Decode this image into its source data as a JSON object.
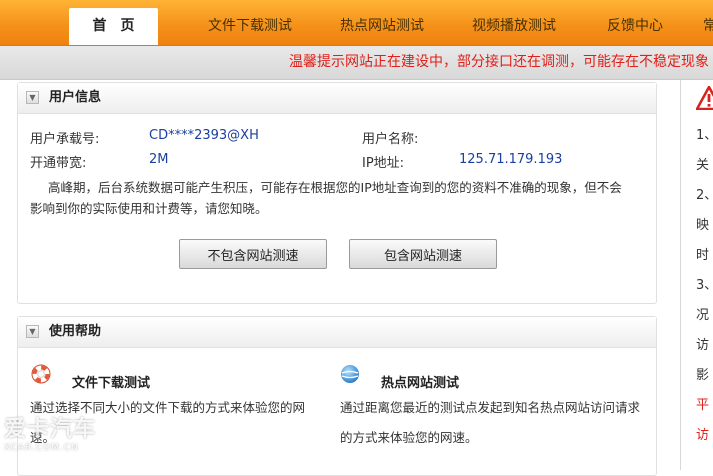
{
  "nav": {
    "tabs": [
      {
        "label": "首页"
      },
      {
        "label": "文件下载测试"
      },
      {
        "label": "热点网站测试"
      },
      {
        "label": "视频播放测试"
      },
      {
        "label": "反馈中心"
      },
      {
        "label": "常"
      }
    ]
  },
  "notice": {
    "text": "温馨提示网站正在建设中，部分接口还在调测，可能存在不稳定现象"
  },
  "user_info": {
    "title": "用户信息",
    "account_label": "用户承载号:",
    "account_value": "CD****2393@XH",
    "name_label": "用户名称:",
    "name_value": "",
    "bandwidth_label": "开通带宽:",
    "bandwidth_value": "2M",
    "ip_label": "IP地址:",
    "ip_value": "125.71.179.193",
    "note": "高峰期，后台系统数据可能产生积压，可能存在根据您的IP地址查询到的您的资料不准确的现象，但不会影响到你的实际使用和计费等，请您知晓。",
    "btn_exclude": "不包含网站测速",
    "btn_include": "包含网站测速"
  },
  "help": {
    "title": "使用帮助",
    "items": [
      {
        "icon": "lifebuoy-icon",
        "title": "文件下载测试",
        "desc": "通过选择不同大小的文件下载的方式来体验您的网速。"
      },
      {
        "icon": "globe-icon",
        "title": "热点网站测试",
        "desc": "通过距离您最近的测试点发起到知名热点网站访问请求的方式来体验您的网速。"
      }
    ]
  },
  "sidebar": {
    "lines": [
      "1、",
      "关",
      "2、",
      "映",
      "时",
      "3、",
      "况",
      "访",
      "影",
      "平",
      "访"
    ]
  },
  "watermark": {
    "big": "爱卡汽车",
    "small": "XCAR.COM.CN"
  },
  "colors": {
    "nav_orange": "#f5921a",
    "notice_red": "#e0201a",
    "value_blue": "#1a3fa0"
  }
}
